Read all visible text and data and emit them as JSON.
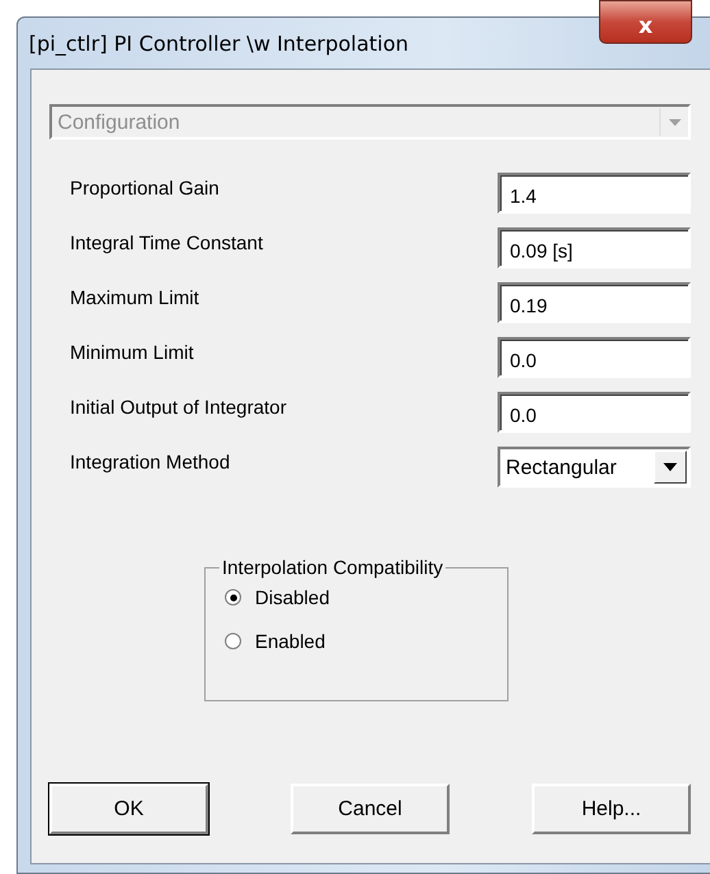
{
  "window": {
    "title": "[pi_ctlr] PI Controller \\w Interpolation",
    "close": "x"
  },
  "section_dropdown": {
    "value": "Configuration",
    "disabled": true
  },
  "parameters": [
    {
      "kind": "text",
      "label": "Proportional Gain",
      "value": "1.4"
    },
    {
      "kind": "text",
      "label": "Integral Time Constant",
      "value": "0.09 [s]"
    },
    {
      "kind": "text",
      "label": "Maximum Limit",
      "value": "0.19"
    },
    {
      "kind": "text",
      "label": "Minimum Limit",
      "value": "0.0"
    },
    {
      "kind": "text",
      "label": "Initial Output of Integrator",
      "value": "0.0"
    },
    {
      "kind": "dropdown",
      "label": "Integration Method",
      "value": "Rectangular"
    }
  ],
  "group": {
    "title": "Interpolation Compatibility",
    "options": [
      {
        "label": "Disabled",
        "selected": true
      },
      {
        "label": "Enabled",
        "selected": false
      }
    ]
  },
  "buttons": [
    {
      "label": "OK",
      "default": true
    },
    {
      "label": "Cancel",
      "default": false
    },
    {
      "label": "Help...",
      "default": false
    }
  ]
}
